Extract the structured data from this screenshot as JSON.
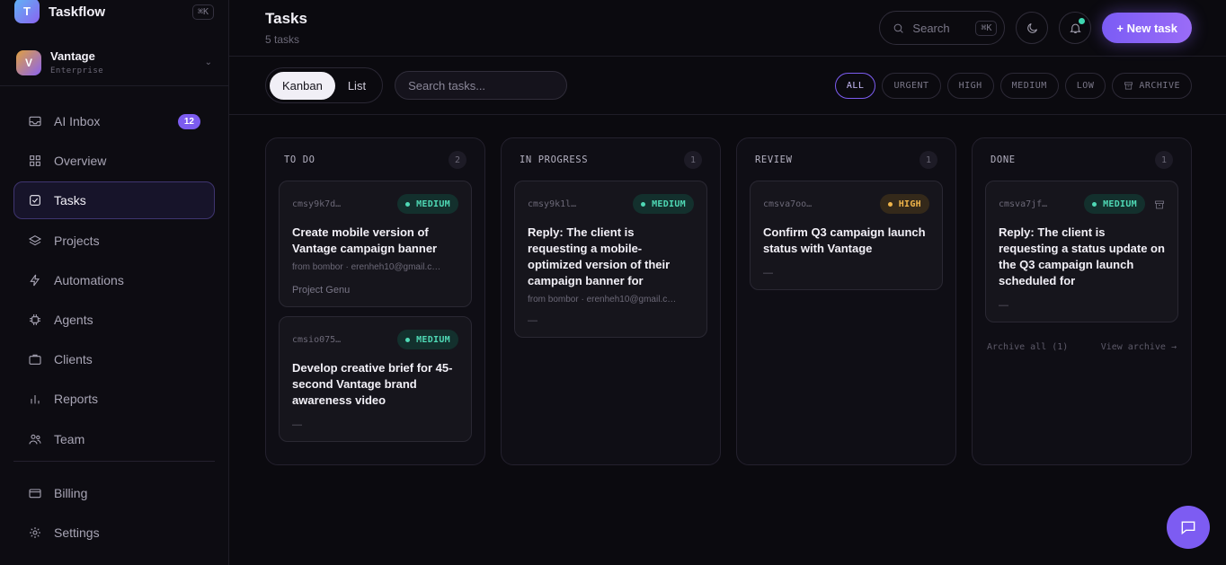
{
  "brand": {
    "logo_letter": "T",
    "name": "Taskflow",
    "shortcut": "⌘K"
  },
  "workspace": {
    "avatar_letter": "V",
    "name": "Vantage",
    "plan": "Enterprise"
  },
  "nav": {
    "items": [
      {
        "label": "AI Inbox",
        "icon": "inbox-icon",
        "badge": "12"
      },
      {
        "label": "Overview",
        "icon": "grid-icon"
      },
      {
        "label": "Tasks",
        "icon": "checkbox-icon",
        "active": true
      },
      {
        "label": "Projects",
        "icon": "layers-icon"
      },
      {
        "label": "Automations",
        "icon": "bolt-icon"
      },
      {
        "label": "Agents",
        "icon": "chip-icon"
      },
      {
        "label": "Clients",
        "icon": "briefcase-icon"
      },
      {
        "label": "Reports",
        "icon": "bar-chart-icon"
      },
      {
        "label": "Team",
        "icon": "users-icon"
      }
    ],
    "bottom": [
      {
        "label": "Billing",
        "icon": "credit-card-icon"
      },
      {
        "label": "Settings",
        "icon": "gear-icon"
      }
    ]
  },
  "header": {
    "title": "Tasks",
    "subtitle": "5 tasks",
    "search_label": "Search",
    "search_shortcut": "⌘K",
    "new_task_label": "+ New task"
  },
  "toolbar": {
    "views": [
      "Kanban",
      "List"
    ],
    "active_view": "Kanban",
    "search_placeholder": "Search tasks...",
    "filters": [
      "ALL",
      "URGENT",
      "HIGH",
      "MEDIUM",
      "LOW",
      "ARCHIVE"
    ],
    "active_filter": "ALL"
  },
  "columns": [
    {
      "title": "TO DO",
      "count": "2",
      "cards": [
        {
          "id": "cmsy9k7d…",
          "priority": "MEDIUM",
          "title": "Create mobile version of Vantage campaign banner",
          "meta": "from bombor · erenheh10@gmail.c…",
          "extra": "Project Genu"
        },
        {
          "id": "cmsio075…",
          "priority": "MEDIUM",
          "title": "Develop creative brief for 45-second Vantage brand awareness video",
          "extra": "—"
        }
      ]
    },
    {
      "title": "IN PROGRESS",
      "count": "1",
      "cards": [
        {
          "id": "cmsy9k1l…",
          "priority": "MEDIUM",
          "title": "Reply: The client is requesting a mobile-optimized version of their campaign banner for",
          "meta": "from bombor · erenheh10@gmail.c…",
          "extra": "—"
        }
      ]
    },
    {
      "title": "REVIEW",
      "count": "1",
      "cards": [
        {
          "id": "cmsva7oo…",
          "priority": "HIGH",
          "title": "Confirm Q3 campaign launch status with Vantage",
          "extra": "—"
        }
      ]
    },
    {
      "title": "DONE",
      "count": "1",
      "cards": [
        {
          "id": "cmsva7jf…",
          "priority": "MEDIUM",
          "title": "Reply: The client is requesting a status update on the Q3 campaign launch scheduled for",
          "extra": "—"
        }
      ],
      "footer_left": "Archive all (1)",
      "footer_right": "View archive →"
    }
  ],
  "colors": {
    "accent": "#7c5cf0",
    "medium": "#4fd9b5",
    "high": "#f0b54a",
    "notification": "#3ed6b0"
  }
}
